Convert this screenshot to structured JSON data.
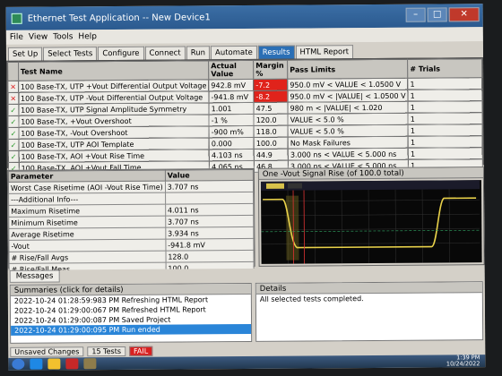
{
  "window": {
    "title": "Ethernet Test Application -- New Device1"
  },
  "menu": [
    "File",
    "View",
    "Tools",
    "Help"
  ],
  "tabs": [
    "Set Up",
    "Select Tests",
    "Configure",
    "Connect",
    "Run",
    "Automate",
    "Results",
    "HTML Report"
  ],
  "active_tab": "Results",
  "results_table": {
    "headers": [
      "Test Name",
      "Actual Value",
      "Margin %",
      "Pass Limits",
      "# Trials"
    ],
    "rows": [
      {
        "status": "fail",
        "name": "100 Base-TX, UTP +Vout Differential Output Voltage",
        "actual": "942.8 mV",
        "margin": "-7.2",
        "limits": "950.0 mV < VALUE < 1.0500 V",
        "trials": "1"
      },
      {
        "status": "fail",
        "name": "100 Base-TX, UTP -Vout Differential Output Voltage",
        "actual": "-941.8 mV",
        "margin": "-8.2",
        "limits": "950.0 mV < |VALUE| < 1.0500 V",
        "trials": "1"
      },
      {
        "status": "pass",
        "name": "100 Base-TX, UTP Signal Amplitude Symmetry",
        "actual": "1.001",
        "margin": "47.5",
        "limits": "980 m < |VALUE| < 1.020",
        "trials": "1"
      },
      {
        "status": "pass",
        "name": "100 Base-TX, +Vout Overshoot",
        "actual": "-1 %",
        "margin": "120.0",
        "limits": "VALUE < 5.0 %",
        "trials": "1"
      },
      {
        "status": "pass",
        "name": "100 Base-TX, -Vout Overshoot",
        "actual": "-900 m%",
        "margin": "118.0",
        "limits": "VALUE < 5.0 %",
        "trials": "1"
      },
      {
        "status": "pass",
        "name": "100 Base-TX, UTP AOI Template",
        "actual": "0.000",
        "margin": "100.0",
        "limits": "No Mask Failures",
        "trials": "1"
      },
      {
        "status": "pass",
        "name": "100 Base-TX, AOI +Vout Rise Time",
        "actual": "4.103 ns",
        "margin": "44.9",
        "limits": "3.000 ns < VALUE < 5.000 ns",
        "trials": "1"
      },
      {
        "status": "pass",
        "name": "100 Base-TX, AOI +Vout Fall Time",
        "actual": "4.065 ns",
        "margin": "46.8",
        "limits": "3.000 ns < VALUE < 5.000 ns",
        "trials": "1"
      }
    ]
  },
  "params_table": {
    "headers": [
      "Parameter",
      "Value"
    ],
    "rows": [
      {
        "name": "Worst Case Risetime (AOI -Vout Rise Time)",
        "value": "3.707 ns"
      },
      {
        "name": "---Additional Info---",
        "value": ""
      },
      {
        "name": "Maximum Risetime",
        "value": "4.011 ns"
      },
      {
        "name": "Minimum Risetime",
        "value": "3.707 ns"
      },
      {
        "name": "Average Risetime",
        "value": "3.934 ns"
      },
      {
        "name": "-Vout",
        "value": "-941.8 mV"
      },
      {
        "name": "# Rise/Fall Avgs",
        "value": "128.0"
      },
      {
        "name": "# Rise/Fall Meas",
        "value": "100.0"
      }
    ]
  },
  "chart_panel": {
    "title": "One -Vout Signal Rise (of 100.0 total)"
  },
  "messages": {
    "tab_label": "Messages",
    "summaries_header": "Summaries (click for details)",
    "details_header": "Details",
    "details_text": "All selected tests completed.",
    "log": [
      "2022-10-24 01:28:59:983 PM Refreshing HTML Report",
      "2022-10-24 01:29:00:067 PM Refreshed HTML Report",
      "2022-10-24 01:29:00:087 PM Saved Project",
      "2022-10-24 01:29:00:095 PM Run ended"
    ],
    "selected_index": 3
  },
  "statusbar": {
    "unsaved": "Unsaved Changes",
    "tests": "15 Tests",
    "result": "FAIL"
  },
  "taskbar": {
    "time": "1:39 PM",
    "date": "10/24/2022"
  },
  "colors": {
    "fail": "#e0231b",
    "pass": "#2e9b2e",
    "accent": "#2b6fb5"
  }
}
